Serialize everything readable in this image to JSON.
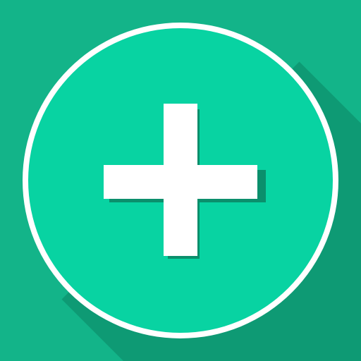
{
  "icon": {
    "semantic_name": "add-plus-icon",
    "shape": "circle-with-plus",
    "style": "flat-long-shadow"
  },
  "colors": {
    "background": "#13B489",
    "long_shadow": "#0E9A74",
    "circle_fill": "#08D3A2",
    "ring": "#FFFFFF",
    "plus": "#FFFFFF",
    "plus_shadow": "#0B8F6C"
  }
}
